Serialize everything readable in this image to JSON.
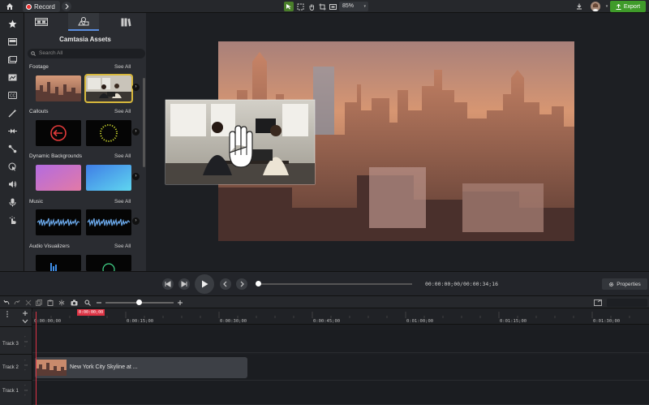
{
  "topbar": {
    "record_label": "Record",
    "zoom_value": "85%",
    "export_label": "Export"
  },
  "assets": {
    "title": "Camtasia Assets",
    "search_placeholder": "Search All",
    "sections": [
      {
        "label": "Footage",
        "see_all": "See All"
      },
      {
        "label": "Callouts",
        "see_all": "See All"
      },
      {
        "label": "Dynamic Backgrounds",
        "see_all": "See All"
      },
      {
        "label": "Music",
        "see_all": "See All"
      },
      {
        "label": "Audio Visualizers",
        "see_all": "See All"
      }
    ]
  },
  "playback": {
    "timecode": "00:00:00;00/00:00:34;16",
    "properties_label": "Properties"
  },
  "timeline": {
    "playhead_time": "0:00:00;00",
    "ticks": [
      "0:00:00;00",
      "0:00:15;00",
      "0:00:30;00",
      "0:00:45;00",
      "0:01:00;00",
      "0:01:15;00",
      "0:01:30;00"
    ],
    "tracks": [
      {
        "label": "Track 3"
      },
      {
        "label": "Track 2"
      },
      {
        "label": "Track 1"
      }
    ],
    "clip_label": "New York City Skyline at ..."
  },
  "colors": {
    "accent": "#3f9b2a",
    "selection": "#d7b83c",
    "playhead": "#d33344",
    "record": "#e33333"
  }
}
